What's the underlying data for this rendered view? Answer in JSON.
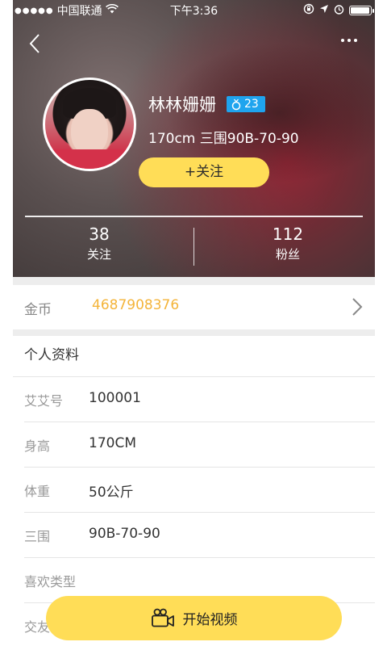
{
  "status_bar": {
    "signal_dots": "●●●●●",
    "carrier": "中国联通",
    "time": "下午3:36",
    "battery_level": 0.9
  },
  "profile_header": {
    "name": "林林姗姗",
    "level_badge": "23",
    "level_badge_color": "#1FA4EE",
    "stats": "170cm 三围90B-70-90",
    "follow_button": "+关注",
    "following_count": "38",
    "following_label": "关注",
    "followers_count": "112",
    "followers_label": "粉丝"
  },
  "coins": {
    "label": "金币",
    "value": "4687908376",
    "value_color": "#F4B43A"
  },
  "personal_info": {
    "title": "个人资料",
    "rows": [
      {
        "label": "艾艾号",
        "value": "100001"
      },
      {
        "label": "身高",
        "value": "170CM"
      },
      {
        "label": "体重",
        "value": "50公斤"
      },
      {
        "label": "三围",
        "value": "90B-70-90"
      },
      {
        "label": "喜欢类型",
        "value": ""
      },
      {
        "label": "交友",
        "value": ""
      }
    ]
  },
  "video_button": {
    "label": "开始视频",
    "color": "#FFDD57"
  },
  "icons": {
    "back": "chevron-left-icon",
    "more": "more-dots-icon",
    "coins_arrow": "chevron-right-icon",
    "video": "video-camera-icon",
    "badge": "ring-icon"
  }
}
